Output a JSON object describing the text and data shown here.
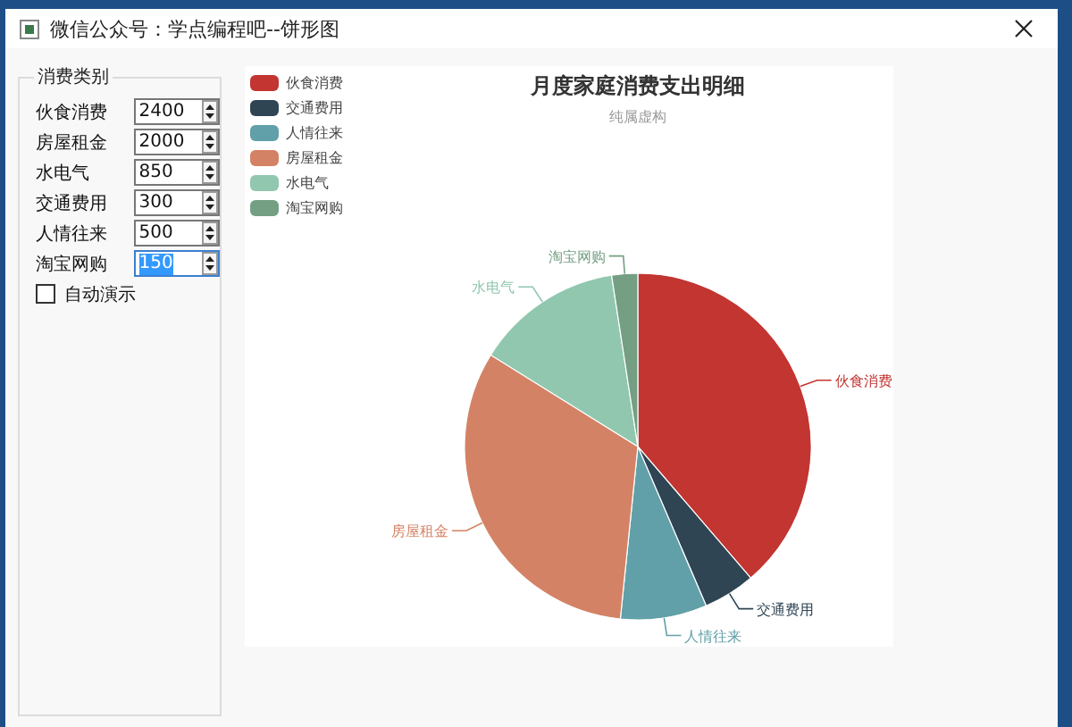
{
  "window": {
    "title": "微信公众号：学点编程吧--饼形图"
  },
  "group": {
    "title": "消费类别",
    "fields": [
      {
        "label": "伙食消费",
        "value": "2400",
        "focused": false
      },
      {
        "label": "房屋租金",
        "value": "2000",
        "focused": false
      },
      {
        "label": "水电气",
        "value": "850",
        "focused": false
      },
      {
        "label": "交通费用",
        "value": "300",
        "focused": false
      },
      {
        "label": "人情往来",
        "value": "500",
        "focused": false
      },
      {
        "label": "淘宝网购",
        "value": "150",
        "focused": true
      }
    ],
    "auto_demo": {
      "label": "自动演示",
      "checked": false
    }
  },
  "chart": {
    "subtitle": "纯属虚构",
    "chart_data": {
      "type": "pie",
      "title": "月度家庭消费支出明细",
      "legend": true,
      "categories": [
        "伙食消费",
        "交通费用",
        "人情往来",
        "房屋租金",
        "水电气",
        "淘宝网购"
      ],
      "values": [
        38.71,
        4.84,
        8.06,
        32.26,
        13.71,
        2.42
      ],
      "colors": [
        "#c23531",
        "#2f4554",
        "#61a0a8",
        "#d48265",
        "#91c7ae",
        "#749f83"
      ]
    }
  }
}
